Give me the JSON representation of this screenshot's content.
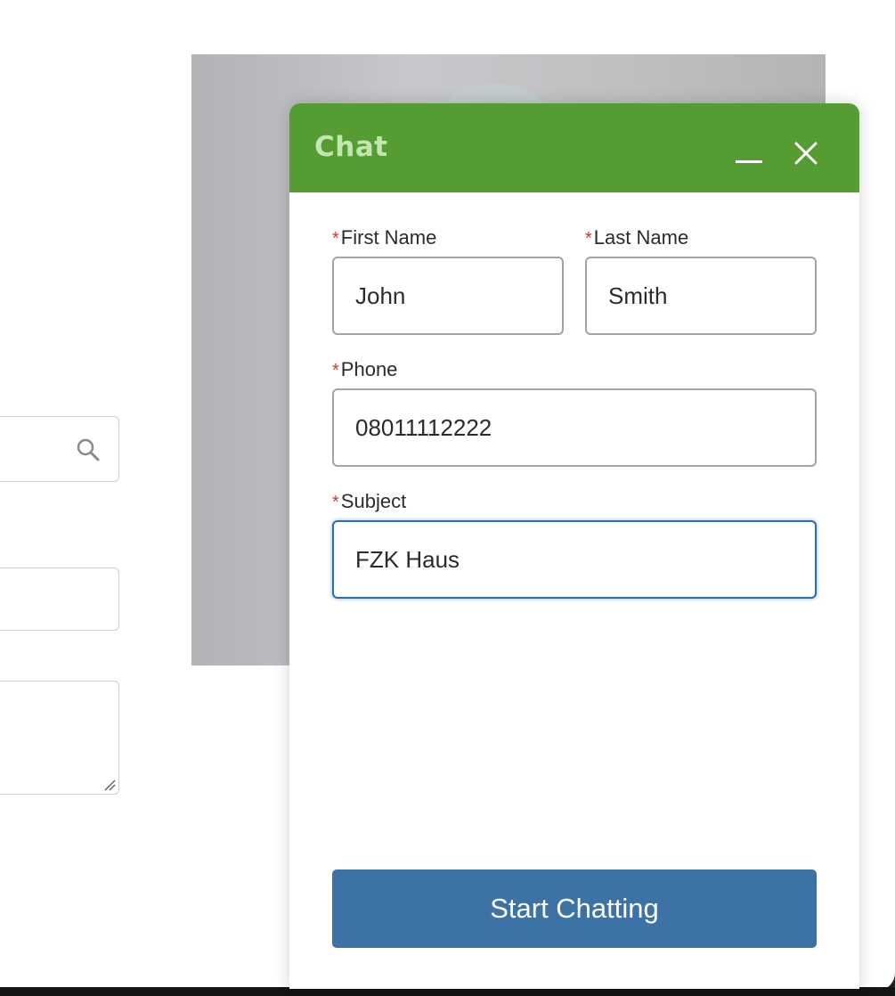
{
  "chat": {
    "title": "Chat",
    "required_marker": "*",
    "fields": {
      "first_name": {
        "label": "First Name",
        "value": "John"
      },
      "last_name": {
        "label": "Last Name",
        "value": "Smith"
      },
      "phone": {
        "label": "Phone",
        "value": "08011112222"
      },
      "subject": {
        "label": "Subject",
        "value": "FZK Haus"
      }
    },
    "submit_label": "Start Chatting"
  },
  "colors": {
    "header_green": "#559c32",
    "title_text": "#c3e5b0",
    "button_blue": "#3c72a6",
    "required_red": "#c23934",
    "focus_blue": "#2b6cb0"
  },
  "icons": {
    "minimize": "minimize-icon",
    "close": "close-icon",
    "search": "search-icon",
    "resize": "resize-handle-icon"
  }
}
